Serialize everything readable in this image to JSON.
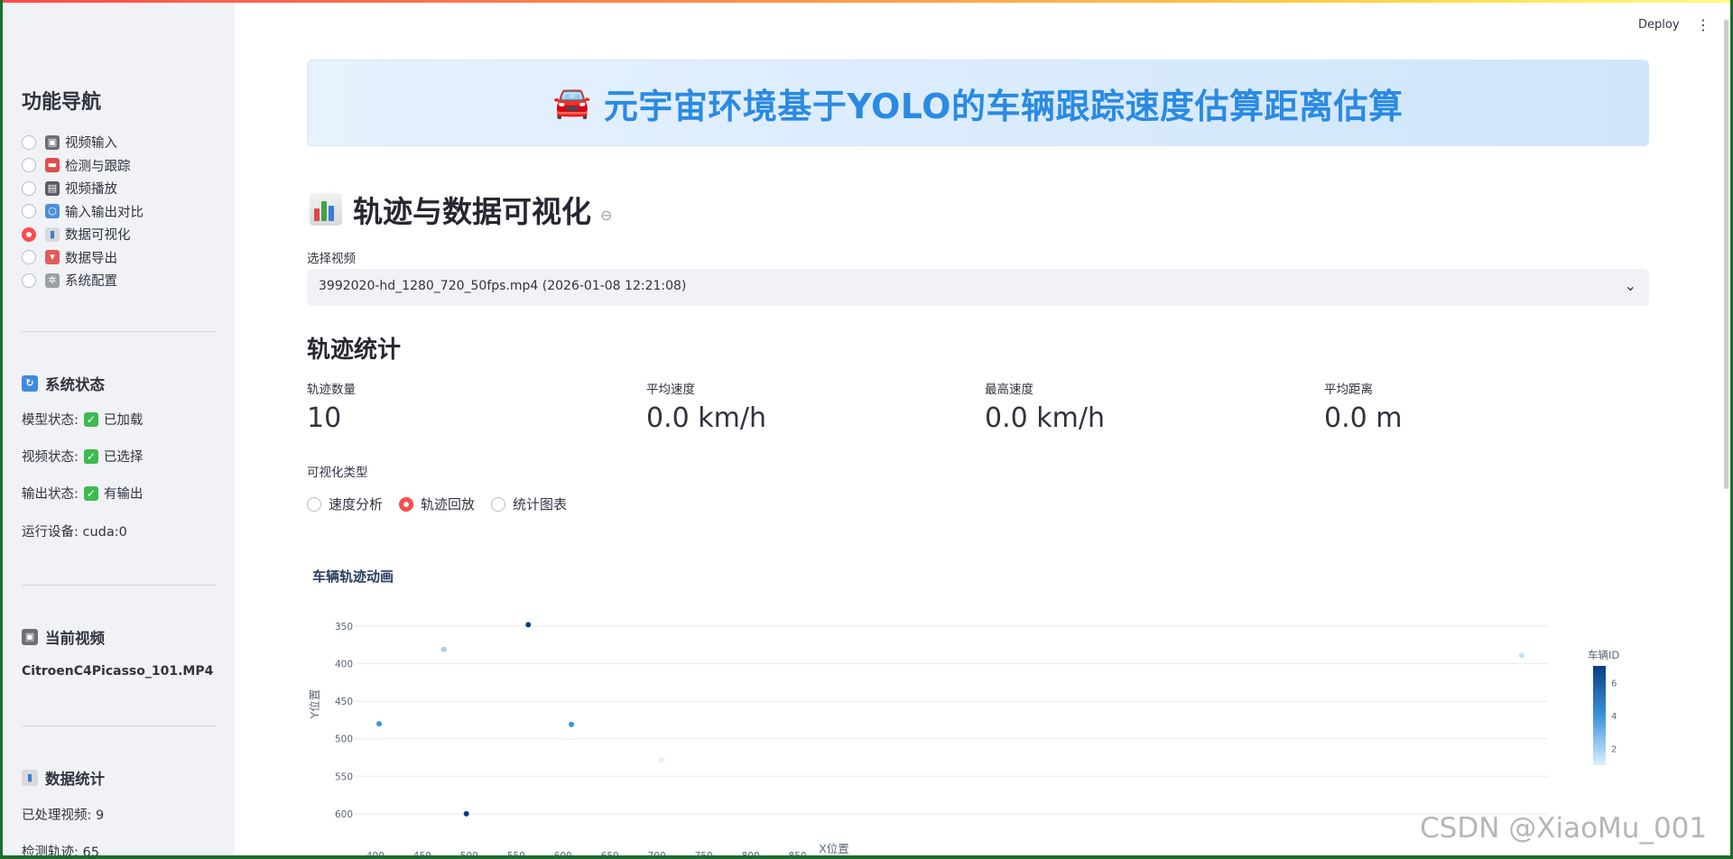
{
  "sidebar": {
    "title": "功能导航",
    "nav": [
      {
        "label": "视频输入",
        "icon": "video-camera-icon",
        "selected": false
      },
      {
        "label": "检测与跟踪",
        "icon": "car-icon",
        "selected": false
      },
      {
        "label": "视频播放",
        "icon": "clapper-icon",
        "selected": false
      },
      {
        "label": "输入输出对比",
        "icon": "magnifier-icon",
        "selected": false
      },
      {
        "label": "数据可视化",
        "icon": "bar-chart-icon",
        "selected": true
      },
      {
        "label": "数据导出",
        "icon": "outbox-icon",
        "selected": false
      },
      {
        "label": "系统配置",
        "icon": "gear-icon",
        "selected": false
      }
    ],
    "system_status": {
      "heading": "系统状态",
      "model_label": "模型状态:",
      "model_value": "已加载",
      "video_label": "视频状态:",
      "video_value": "已选择",
      "output_label": "输出状态:",
      "output_value": "有输出",
      "device_text": "运行设备: cuda:0"
    },
    "current_video": {
      "heading": "当前视频",
      "filename": "CitroenC4Picasso_101.MP4"
    },
    "data_stats": {
      "heading": "数据统计",
      "processed": "已处理视频: 9",
      "tracks": "检测轨迹: 65"
    }
  },
  "header": {
    "deploy_label": "Deploy",
    "menu_glyph": "⋮"
  },
  "banner": {
    "emoji": "🚘",
    "title": "元宇宙环境基于YOLO的车辆跟踪速度估算距离估算"
  },
  "section": {
    "title": "轨迹与数据可视化",
    "link_glyph": "⊖"
  },
  "video_select": {
    "label": "选择视频",
    "value": "3992020-hd_1280_720_50fps.mp4 (2026-01-08 12:21:08)"
  },
  "stats": {
    "title": "轨迹统计",
    "metrics": [
      {
        "label": "轨迹数量",
        "value": "10"
      },
      {
        "label": "平均速度",
        "value": "0.0 km/h"
      },
      {
        "label": "最高速度",
        "value": "0.0 km/h"
      },
      {
        "label": "平均距离",
        "value": "0.0 m"
      }
    ]
  },
  "viz_type": {
    "label": "可视化类型",
    "options": [
      "速度分析",
      "轨迹回放",
      "统计图表"
    ],
    "selected": "轨迹回放"
  },
  "chart_data": {
    "type": "scatter",
    "title": "车辆轨迹动画",
    "xlabel": "X位置",
    "ylabel": "Y位置",
    "xlim": [
      378,
      1650
    ],
    "ylim": [
      350,
      600
    ],
    "y_reversed": true,
    "xticks": [
      400,
      450,
      500,
      550,
      600,
      650,
      700,
      750,
      800,
      850
    ],
    "yticks": [
      350,
      400,
      450,
      500,
      550,
      600
    ],
    "colorbar": {
      "title": "车辆ID",
      "ticks": [
        2,
        4,
        6
      ],
      "range": [
        1,
        7
      ]
    },
    "points": [
      {
        "x": 404,
        "y": 480,
        "id": 4
      },
      {
        "x": 473,
        "y": 381,
        "id": 2
      },
      {
        "x": 497,
        "y": 600,
        "id": 7
      },
      {
        "x": 563,
        "y": 348,
        "id": 7
      },
      {
        "x": 609,
        "y": 481,
        "id": 4
      },
      {
        "x": 705,
        "y": 528,
        "id": 1
      },
      {
        "x": 1622,
        "y": 389,
        "id": 1.5
      }
    ],
    "grid": true
  },
  "watermark": "CSDN @XiaoMu_001"
}
